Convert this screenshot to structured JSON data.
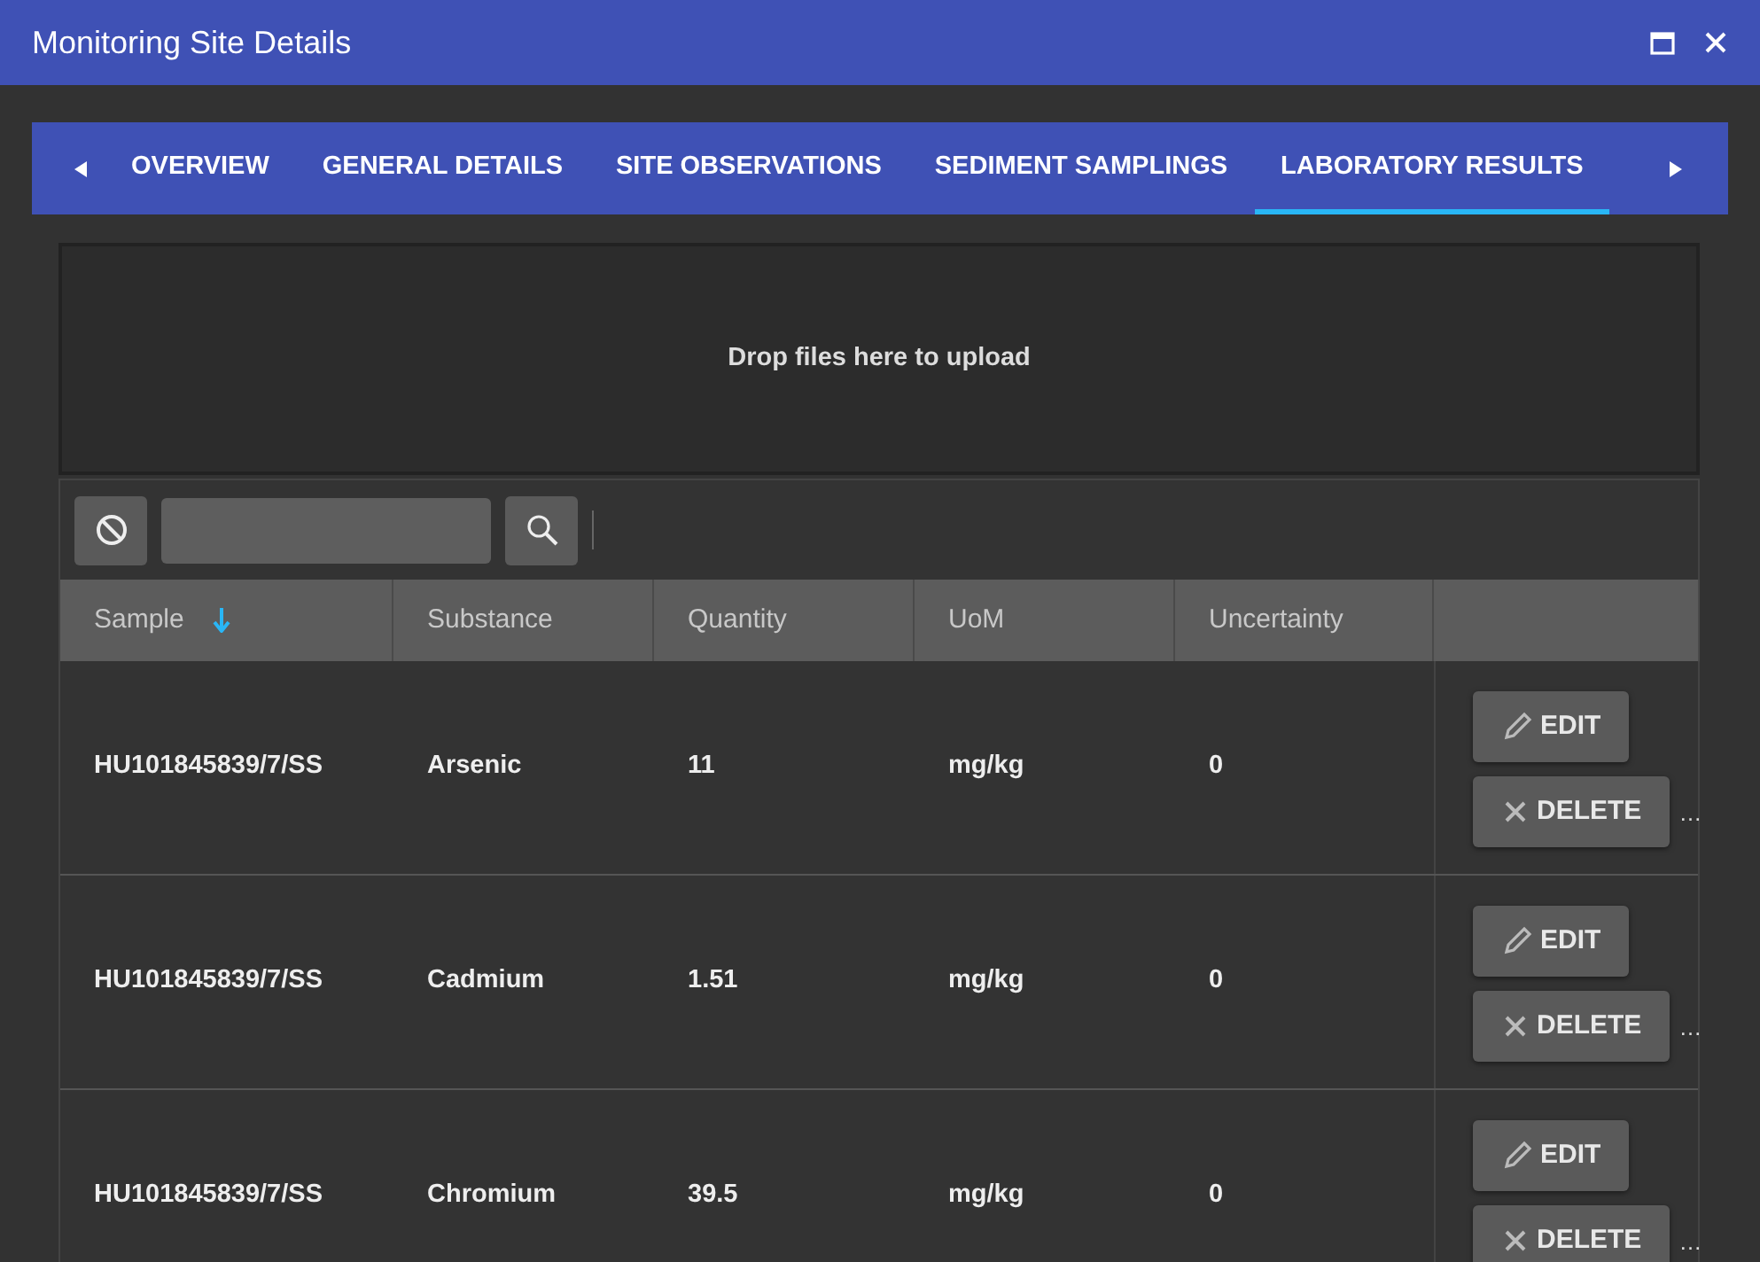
{
  "window": {
    "title": "Monitoring Site Details"
  },
  "tabs": [
    {
      "label": "OVERVIEW",
      "selected": false
    },
    {
      "label": "GENERAL DETAILS",
      "selected": false
    },
    {
      "label": "SITE OBSERVATIONS",
      "selected": false
    },
    {
      "label": "SEDIMENT SAMPLINGS",
      "selected": false
    },
    {
      "label": "LABORATORY RESULTS",
      "selected": true
    }
  ],
  "upload": {
    "text": "Drop files here to upload"
  },
  "table": {
    "columns": [
      {
        "label": "Sample",
        "sorted": true
      },
      {
        "label": "Substance",
        "sorted": false
      },
      {
        "label": "Quantity",
        "sorted": false
      },
      {
        "label": "UoM",
        "sorted": false
      },
      {
        "label": "Uncertainty",
        "sorted": false
      }
    ],
    "rows": [
      {
        "cells": [
          "HU101845839/7/SS",
          "Arsenic",
          "11",
          "mg/kg",
          "0"
        ],
        "actions": [
          "EDIT",
          "DELETE"
        ],
        "more": "…"
      },
      {
        "cells": [
          "HU101845839/7/SS",
          "Cadmium",
          "1.51",
          "mg/kg",
          "0"
        ],
        "actions": [
          "EDIT",
          "DELETE"
        ],
        "more": "…"
      },
      {
        "cells": [
          "HU101845839/7/SS",
          "Chromium",
          "39.5",
          "mg/kg",
          "0"
        ],
        "actions": [
          "EDIT",
          "DELETE"
        ],
        "more": "…"
      }
    ]
  }
}
